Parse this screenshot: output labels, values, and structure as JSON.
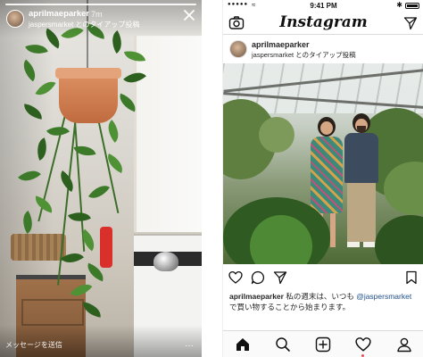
{
  "story": {
    "username": "aprilmaeparker",
    "time": "7m",
    "subline": "jaspersmarket とのタイアップ投稿",
    "reply_placeholder": "メッセージを送信",
    "more_label": "…"
  },
  "feed": {
    "status": {
      "signal": "●●●●●",
      "wifi": "≈",
      "clock": "9:41 PM",
      "bluetooth": "✱"
    },
    "app": {
      "logo": "Instagram"
    },
    "post": {
      "username": "aprilmaeparker",
      "sponsor_line": "jaspersmarket とのタイアップ投稿",
      "caption_user": "aprilmaeparker",
      "caption_text_1": " 私の週末は、いつも ",
      "caption_tag": "@jaspersmarket",
      "caption_text_2": " で買い物することから始まります。"
    }
  },
  "icons": {
    "story": [
      "close-icon"
    ],
    "appbar": [
      "camera-icon",
      "direct-message-icon"
    ],
    "actions": [
      "heart-icon",
      "comment-icon",
      "share-icon",
      "bookmark-icon"
    ],
    "tabs": [
      "home-icon",
      "search-icon",
      "new-post-icon",
      "activity-icon",
      "profile-icon"
    ]
  },
  "colors": {
    "text": "#262626",
    "mention": "#1e4f8a",
    "notification_dot": "#ed4956",
    "divider": "#dbdbdb"
  }
}
